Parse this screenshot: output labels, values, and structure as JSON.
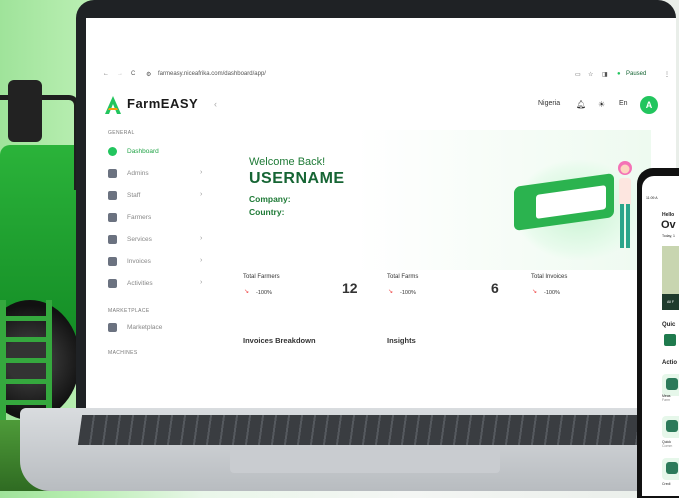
{
  "browser": {
    "url": "farmeasy.niceafrika.com/dashboard/app/",
    "status": "Paused"
  },
  "app": {
    "brand": "FarmEASY",
    "brand_color": "#22c55e",
    "country": "Nigeria",
    "language": "En",
    "avatar_letter": "A"
  },
  "sidebar": {
    "general_label": "GENERAL",
    "items": [
      {
        "label": "Dashboard",
        "icon": "dashboard-icon"
      },
      {
        "label": "Admins",
        "icon": "user-icon"
      },
      {
        "label": "Staff",
        "icon": "user-icon"
      },
      {
        "label": "Farmers",
        "icon": "users-icon"
      },
      {
        "label": "Services",
        "icon": "services-icon"
      },
      {
        "label": "Invoices",
        "icon": "invoice-icon"
      },
      {
        "label": "Activities",
        "icon": "activity-icon"
      }
    ],
    "marketplace_label": "MARKETPLACE",
    "marketplace_item": "Marketplace",
    "machines_label": "MACHINES"
  },
  "hero": {
    "welcome": "Welcome Back!",
    "username": "USERNAME",
    "company_label": "Company:",
    "country_label": "Country:"
  },
  "stats": [
    {
      "label": "Total Farmers",
      "pct": "-100%",
      "value": "12"
    },
    {
      "label": "Total Farms",
      "pct": "-100%",
      "value": "6"
    },
    {
      "label": "Total Invoices",
      "pct": "-100%",
      "value": ""
    }
  ],
  "sections": {
    "invoices": "Invoices Breakdown",
    "insights": "Insights"
  },
  "phone": {
    "time": "11:09 A",
    "hello": "Hello",
    "title": "Ov",
    "today": "Today, 1",
    "quick": "Quic",
    "actions": "Actio",
    "m1": "Meas",
    "m1b": "Farm",
    "m2": "Quick",
    "m2b": "Comm",
    "m3": "Credi",
    "banner": "All F"
  }
}
